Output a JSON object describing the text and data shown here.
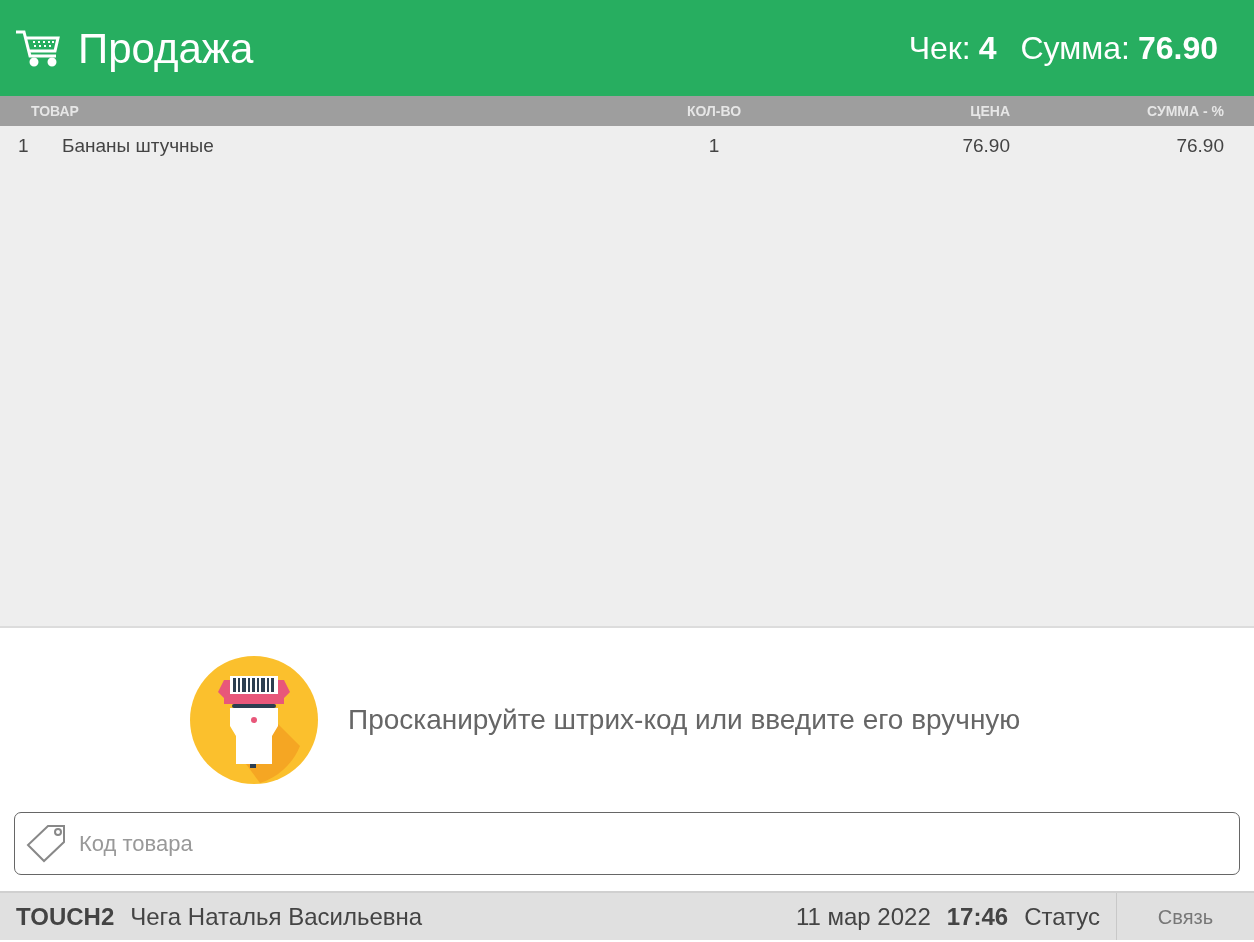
{
  "header": {
    "title": "Продажа",
    "check_label": "Чек:",
    "check_number": "4",
    "sum_label": "Сумма:",
    "sum_value": "76.90"
  },
  "table": {
    "columns": [
      "ТОВАР",
      "КОЛ-ВО",
      "ЦЕНА",
      "СУММА - %"
    ],
    "rows": [
      {
        "number": "1",
        "name": "Бананы штучные",
        "qty": "1",
        "price": "76.90",
        "sum": "76.90"
      }
    ]
  },
  "scan_prompt": "Просканируйте штрих-код или введите его вручную",
  "code_field": {
    "placeholder": "Код товара"
  },
  "status_bar": {
    "terminal": "TOUCH2",
    "cashier": "Чега Наталья Васильевна",
    "date": "11 мар 2022",
    "time": "17:46",
    "status": "Статус",
    "connection_button": "Связь"
  }
}
